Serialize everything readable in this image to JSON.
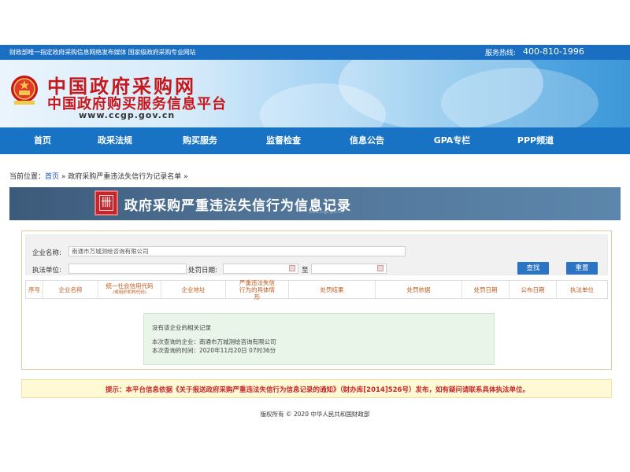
{
  "topbar": {
    "left_text": "财政部唯一指定政府采购信息网络发布媒体  国家级政府采购专业网站",
    "hotline_label": "服务热线:",
    "hotline_number": "400-810-1996"
  },
  "banner": {
    "title_line1": "中国政府采购网",
    "title_line2": "中国政府购买服务信息平台",
    "domain": "www.ccgp.gov.cn"
  },
  "nav": {
    "items": [
      {
        "label": "首页"
      },
      {
        "label": "政采法规"
      },
      {
        "label": "购买服务"
      },
      {
        "label": "监督检查"
      },
      {
        "label": "信息公告"
      },
      {
        "label": "GPA专栏"
      },
      {
        "label": "PPP频道"
      }
    ]
  },
  "breadcrumb": {
    "prefix": "当前位置：",
    "home": "首页",
    "sep1": " » ",
    "current": "政府采购严重违法失信行为记录名单",
    "sep2": " »"
  },
  "record_banner": {
    "title": "政府采购严重违法失信行为信息记录",
    "seal_glyph": "卌",
    "watermark": "www.ccgp.gov.cn"
  },
  "search": {
    "company_label": "企业名称:",
    "company_value": "南通市万城测绘咨询有限公司",
    "unit_label": "执法单位:",
    "unit_value": "",
    "date_label": "处罚日期:",
    "date_from": "",
    "date_sep": "至",
    "date_to": "",
    "search_button": "查找",
    "reset_button": "重置"
  },
  "table": {
    "headers": [
      {
        "label": "序号"
      },
      {
        "label": "企业名称"
      },
      {
        "label": "统一社会信用代码",
        "sub": "(或组织机构代码)"
      },
      {
        "label": "企业地址"
      },
      {
        "label": "严重违法失信行为的具体情形"
      },
      {
        "label": "处罚结果"
      },
      {
        "label": "处罚依据"
      },
      {
        "label": "处罚日期"
      },
      {
        "label": "公布日期"
      },
      {
        "label": "执法单位"
      }
    ]
  },
  "empty_result": {
    "line1": "没有该企业的相关记录",
    "line2": "本次查询的企业：南通市万城测绘咨询有限公司",
    "line3": "本次查询的时间：2020年11月20日 07时36分"
  },
  "notice": {
    "text": "提示：本平台信息依据《关于报送政府采购严重违法失信行为信息记录的通知》（财办库[2014]526号）发布，如有疑问请联系具体执法单位。"
  },
  "footer": {
    "text": "版权所有 © 2020 中华人民共和国财政部"
  },
  "colors": {
    "primary_blue": "#1873c5",
    "title_red": "#c5171c",
    "header_orange": "#c25b1d",
    "notice_red": "#c8252a"
  }
}
